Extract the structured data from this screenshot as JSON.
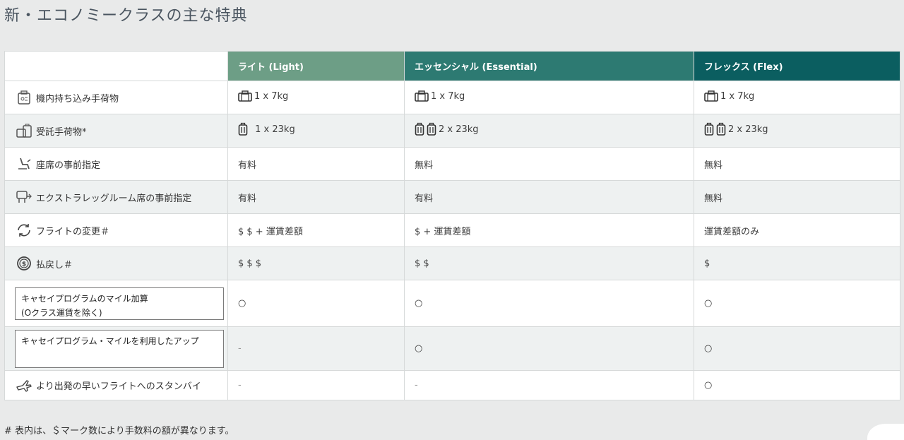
{
  "title": "新・エコノミークラスの主な特典",
  "plans": [
    {
      "label": "ライト (Light)",
      "color": "#6d9e86"
    },
    {
      "label": "エッセンシャル (Essential)",
      "color": "#2d7a72"
    },
    {
      "label": "フレックス (Flex)",
      "color": "#0b5e60"
    }
  ],
  "rows": [
    {
      "feature": "機内持ち込み手荷物",
      "icon": "carry-on-bag-icon",
      "values": [
        "1 x 7kg",
        "1 x 7kg",
        "1 x 7kg"
      ]
    },
    {
      "feature": "受託手荷物*",
      "icon": "checked-luggage-icon",
      "values": [
        "1 x 23kg",
        "2 x 23kg",
        "2 x 23kg"
      ]
    },
    {
      "feature": "座席の事前指定",
      "icon": "seat-icon",
      "values": [
        "有料",
        "無料",
        "無料"
      ]
    },
    {
      "feature": "エクストラレッグルーム席の事前指定",
      "icon": "legroom-seat-icon",
      "values": [
        "有料",
        "有料",
        "無料"
      ]
    },
    {
      "feature": "フライトの変更＃",
      "icon": "change-flight-icon",
      "values": [
        "$ $ + 運賃差額",
        "$ + 運賃差額",
        "運賃差額のみ"
      ]
    },
    {
      "feature": "払戻し＃",
      "icon": "refund-icon",
      "values": [
        "$ $ $",
        "$ $",
        "$"
      ]
    },
    {
      "feature_line1": "キャセイプログラムのマイル加算",
      "feature_line2": "(Oクラス運賃を除く)",
      "values": [
        "○",
        "○",
        "○"
      ]
    },
    {
      "feature": "キャセイプログラム・マイルを利用したアップ",
      "values": [
        "-",
        "○",
        "○"
      ]
    },
    {
      "feature": "より出発の早いフライトへのスタンバイ",
      "icon": "standby-plane-icon",
      "values": [
        "-",
        "-",
        "○"
      ]
    }
  ],
  "footnote": "#  表内は、＄マーク数により手数料の額が異なります。"
}
